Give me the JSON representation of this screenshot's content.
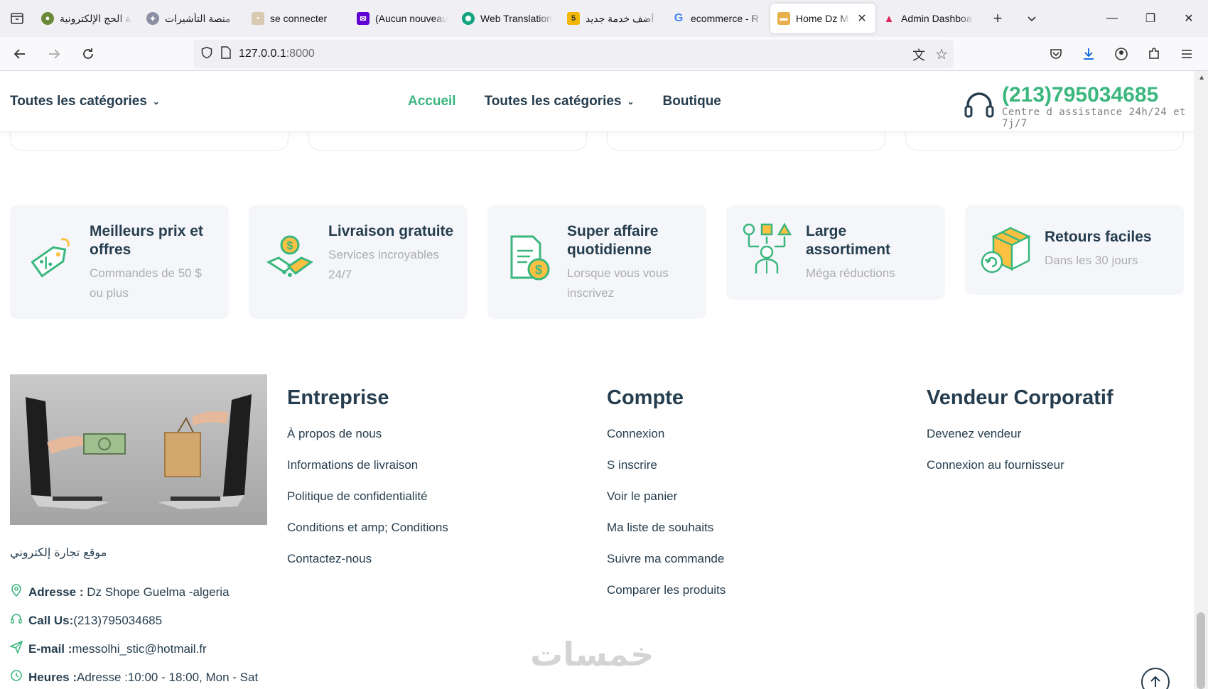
{
  "browser": {
    "tabs": [
      {
        "title": "بوابة الحج الإلكترونية",
        "icon": "hajj-favicon",
        "active": false
      },
      {
        "title": "منصة التأشيرات",
        "icon": "visa-favicon",
        "active": false
      },
      {
        "title": "se connecter",
        "icon": "login-favicon",
        "active": false
      },
      {
        "title": "(Aucun nouveau",
        "icon": "mail-favicon",
        "active": false
      },
      {
        "title": "Web Translation",
        "icon": "openai-favicon",
        "active": false
      },
      {
        "title": "أضف خدمة جديد",
        "icon": "khamsat-favicon",
        "active": false
      },
      {
        "title": "ecommerce - R",
        "icon": "google-favicon",
        "active": false
      },
      {
        "title": "Home Dz Mu",
        "icon": "truck-favicon",
        "active": true
      },
      {
        "title": "Admin Dashboa",
        "icon": "admin-favicon",
        "active": false
      }
    ],
    "url_host": "127.0.0.1",
    "url_port": ":8000"
  },
  "header": {
    "category_dropdown": "Toutes les catégories",
    "menu": {
      "home": "Accueil",
      "categories": "Toutes les catégories",
      "shop": "Boutique"
    },
    "hotline_number": "(213)795034685",
    "hotline_sub": "Centre d assistance 24h/24 et 7j/7"
  },
  "features": [
    {
      "title": "Meilleurs prix et offres",
      "subtitle": "Commandes de 50 $ ou plus",
      "icon": "price-tag-icon"
    },
    {
      "title": "Livraison gratuite",
      "subtitle": "Services incroyables 24/7",
      "icon": "delivery-handshake-icon"
    },
    {
      "title": "Super affaire quotidienne",
      "subtitle": "Lorsque vous vous inscrivez",
      "icon": "invoice-dollar-icon"
    },
    {
      "title": "Large assortiment",
      "subtitle": "Méga réductions",
      "icon": "assortment-icon"
    },
    {
      "title": "Retours faciles",
      "subtitle": "Dans les 30 jours",
      "icon": "return-box-icon"
    }
  ],
  "footer": {
    "tagline": "موقع تجارة إلكتروني",
    "contact": {
      "address_label": "Adresse :",
      "address_value": " Dz Shope Guelma -algeria",
      "phone_label": "Call Us:",
      "phone_value": "(213)795034685",
      "email_label": "E-mail :",
      "email_value": "messolhi_stic@hotmail.fr",
      "hours_label": "Heures :",
      "hours_value": "Adresse :10:00 - 18:00, Mon - Sat"
    },
    "columns": [
      {
        "title": "Entreprise",
        "links": [
          "À propos de nous",
          "Informations de livraison",
          "Politique de confidentialité",
          "Conditions et amp; Conditions",
          "Contactez-nous"
        ]
      },
      {
        "title": "Compte",
        "links": [
          "Connexion",
          "S inscrire",
          "Voir le panier",
          "Ma liste de souhaits",
          "Suivre ma commande",
          "Comparer les produits"
        ]
      },
      {
        "title": "Vendeur Corporatif",
        "links": [
          "Devenez vendeur",
          "Connexion au fournisseur"
        ]
      }
    ],
    "watermark": "خمسات"
  },
  "colors": {
    "brand": "#3bb77e",
    "heading": "#253d4e",
    "muted": "#adadad",
    "feature_bg": "#f4f6fa",
    "accent_yellow": "#fdc040"
  }
}
